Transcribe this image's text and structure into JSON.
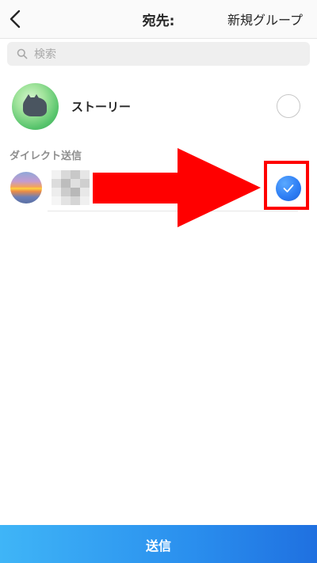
{
  "header": {
    "back_icon": "chevron-left-icon",
    "title": "宛先:",
    "new_group_label": "新規グループ"
  },
  "search": {
    "icon": "search-icon",
    "placeholder": "検索",
    "value": ""
  },
  "story": {
    "label": "ストーリー",
    "selected": false
  },
  "direct_section": {
    "label": "ダイレクト送信",
    "contacts": [
      {
        "name_hidden": true,
        "selected": true
      }
    ]
  },
  "annotation": {
    "arrow_color": "#ff0000",
    "highlight_color": "#ff0000"
  },
  "footer": {
    "send_label": "送信"
  },
  "colors": {
    "accent": "#3897f0",
    "send_gradient_start": "#3fb5f7",
    "send_gradient_end": "#1f70e0",
    "section_label": "#8e8e8e"
  }
}
